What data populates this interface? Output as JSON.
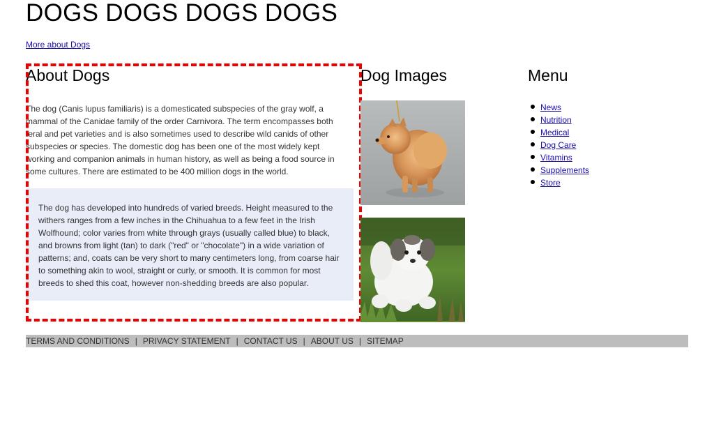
{
  "header": {
    "title": "DOGS DOGS DOGS DOGS",
    "more_link": "More about Dogs"
  },
  "about": {
    "heading": "About Dogs",
    "paragraph": "The dog (Canis lupus familiaris) is a domesticated subspecies of the gray wolf, a mammal of the Canidae family of the order Carnivora. The term encompasses both feral and pet varieties and is also sometimes used to describe wild canids of other subspecies or species. The domestic dog has been one of the most widely kept working and companion animals in human history, as well as being a food source in some cultures. There are estimated to be 400 million dogs in the world.",
    "breeds_paragraph": "The dog has developed into hundreds of varied breeds. Height measured to the withers ranges from a few inches in the Chihuahua to a few feet in the Irish Wolfhound; color varies from white through grays (usually called blue) to black, and browns from light (tan) to dark (\"red\" or \"chocolate\") in a wide variation of patterns; and, coats can be very short to many centimeters long, from coarse hair to something akin to wool, straight or curly, or smooth. It is common for most breeds to shed this coat, however non-shedding breeds are also popular."
  },
  "images": {
    "heading": "Dog Images"
  },
  "menu": {
    "heading": "Menu",
    "items": [
      {
        "label": "News"
      },
      {
        "label": "Nutrition"
      },
      {
        "label": "Medical"
      },
      {
        "label": "Dog Care"
      },
      {
        "label": "Vitamins"
      },
      {
        "label": "Supplements"
      },
      {
        "label": "Store"
      }
    ]
  },
  "footer": {
    "links": [
      {
        "label": "TERMS AND CONDITIONS"
      },
      {
        "label": "PRIVACY STATEMENT"
      },
      {
        "label": "CONTACT US"
      },
      {
        "label": "ABOUT US"
      },
      {
        "label": "SITEMAP"
      }
    ],
    "separator": "|"
  },
  "colors": {
    "link": "#1a0dab",
    "highlight_border": "#ee0000",
    "breeds_box_bg": "#e8edf8",
    "footer_bg": "#bdbdbd"
  }
}
